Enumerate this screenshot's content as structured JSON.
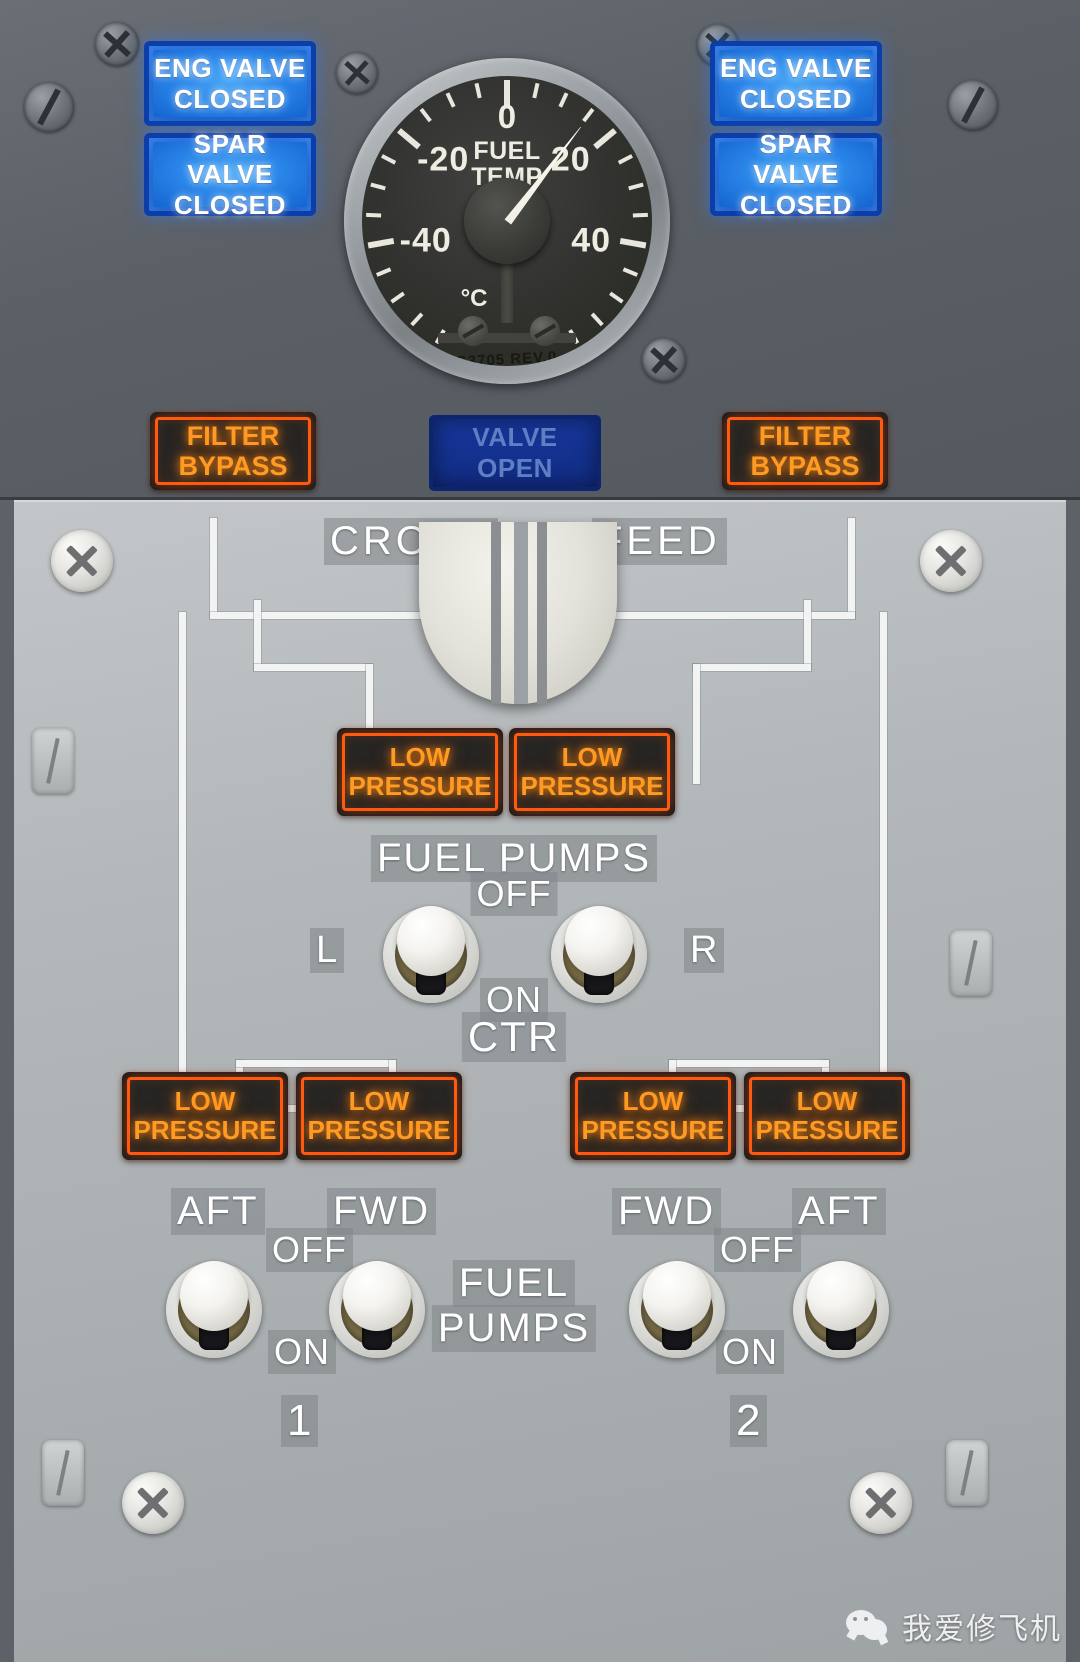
{
  "panel": {
    "upper_title": "fuel-indication-panel",
    "lower_title": "fuel-pump-control-panel"
  },
  "upper": {
    "annunciators_left": [
      {
        "line1": "ENG VALVE",
        "line2": "CLOSED",
        "state": "illuminated",
        "color": "#2b87ea"
      },
      {
        "line1": "SPAR VALVE",
        "line2": "CLOSED",
        "state": "illuminated",
        "color": "#2b87ea"
      }
    ],
    "annunciators_right": [
      {
        "line1": "ENG VALVE",
        "line2": "CLOSED",
        "state": "illuminated",
        "color": "#2b87ea"
      },
      {
        "line1": "SPAR VALVE",
        "line2": "CLOSED",
        "state": "illuminated",
        "color": "#2b87ea"
      }
    ],
    "filter_bypass_left": {
      "line1": "FILTER",
      "line2": "BYPASS",
      "color": "#ff9a22"
    },
    "filter_bypass_right": {
      "line1": "FILTER",
      "line2": "BYPASS",
      "color": "#ff9a22"
    },
    "valve_open": {
      "line1": "VALVE",
      "line2": "OPEN",
      "state": "dim",
      "color": "#5f7ec4"
    }
  },
  "gauge": {
    "title_line1": "FUEL",
    "title_line2": "TEMP",
    "zero_label": "0",
    "unit": "°C",
    "part_code": "S3705 REV.0",
    "reading": 15,
    "major_labels": [
      "-40",
      "-20",
      "20",
      "40"
    ]
  },
  "chart_data": {
    "type": "gauge",
    "title": "FUEL TEMP",
    "unit": "°C",
    "min": -60,
    "max": 60,
    "major_ticks": [
      -40,
      -20,
      0,
      20,
      40
    ],
    "major_tick_labels": [
      "-40",
      "-20",
      "0",
      "20",
      "40"
    ],
    "minor_tick_interval": 5,
    "value": 15,
    "needle_color": "#f6f4ec",
    "face_color": "#333431"
  },
  "lower": {
    "crossfeed": {
      "label_left": "CROSS",
      "label_right": "FEED",
      "knob_name": "crossfeed-valve-selector",
      "position": "vertical"
    },
    "center_annunciators": [
      {
        "line1": "LOW",
        "line2": "PRESSURE"
      },
      {
        "line1": "LOW",
        "line2": "PRESSURE"
      }
    ],
    "center_pumps": {
      "title": "FUEL PUMPS",
      "off_label": "OFF",
      "on_label": "ON",
      "ctr_label": "CTR",
      "left_label": "L",
      "right_label": "R",
      "switches": [
        {
          "name": "ctr-left-fuel-pump-switch",
          "position": "OFF"
        },
        {
          "name": "ctr-right-fuel-pump-switch",
          "position": "OFF"
        }
      ]
    },
    "left_group": {
      "annunciators": [
        {
          "line1": "LOW",
          "line2": "PRESSURE"
        },
        {
          "line1": "LOW",
          "line2": "PRESSURE"
        }
      ],
      "aft_label": "AFT",
      "fwd_label": "FWD",
      "off_label": "OFF",
      "on_label": "ON",
      "tank_label": "1",
      "switches": [
        {
          "name": "tank1-aft-fuel-pump-switch",
          "position": "OFF"
        },
        {
          "name": "tank1-fwd-fuel-pump-switch",
          "position": "OFF"
        }
      ]
    },
    "right_group": {
      "annunciators": [
        {
          "line1": "LOW",
          "line2": "PRESSURE"
        },
        {
          "line1": "LOW",
          "line2": "PRESSURE"
        }
      ],
      "fwd_label": "FWD",
      "aft_label": "AFT",
      "off_label": "OFF",
      "on_label": "ON",
      "tank_label": "2",
      "switches": [
        {
          "name": "tank2-fwd-fuel-pump-switch",
          "position": "OFF"
        },
        {
          "name": "tank2-aft-fuel-pump-switch",
          "position": "OFF"
        }
      ]
    },
    "center_title_line1": "FUEL",
    "center_title_line2": "PUMPS"
  },
  "watermark": {
    "text": "我爱修飞机",
    "icon": "wechat-icon"
  }
}
